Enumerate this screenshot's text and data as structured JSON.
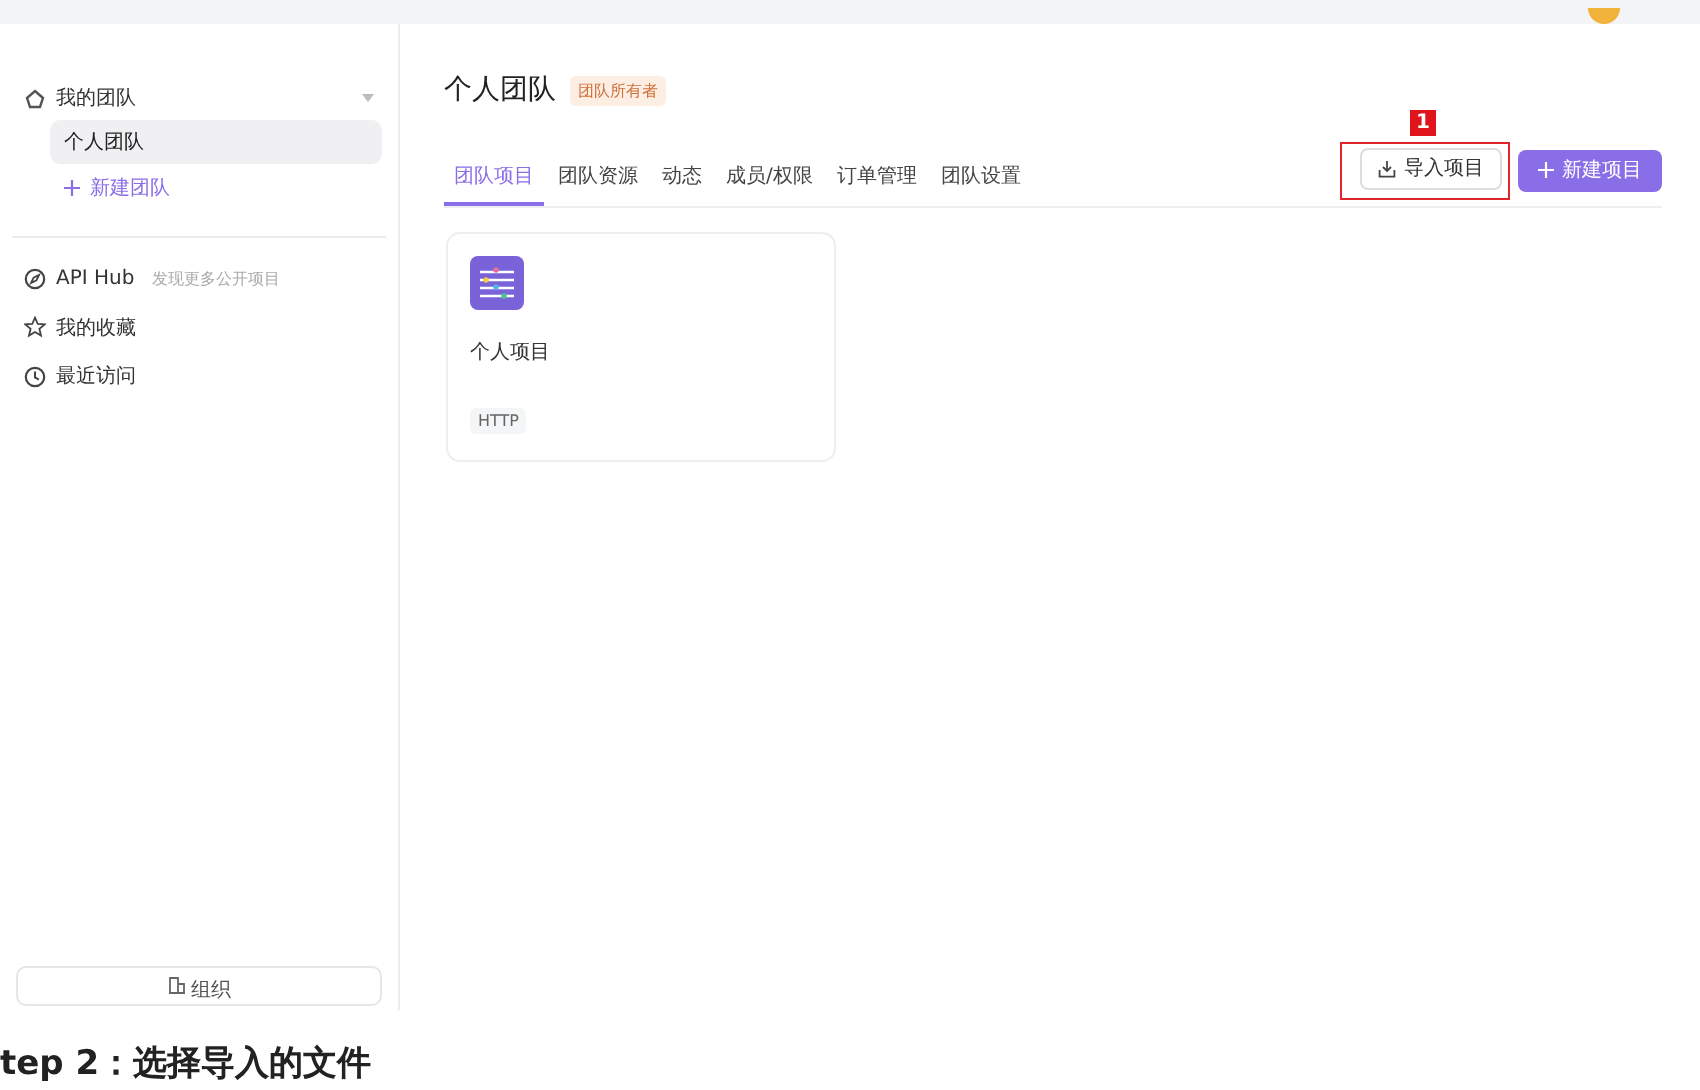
{
  "sidebar": {
    "team_group": {
      "label": "我的团队",
      "expanded": true
    },
    "teams": [
      {
        "label": "个人团队",
        "selected": true
      }
    ],
    "new_team": "新建团队",
    "nav_items": [
      {
        "kind": "hub",
        "label": "API Hub",
        "hint": "发现更多公开项目"
      },
      {
        "kind": "favorites",
        "label": "我的收藏"
      },
      {
        "kind": "recent",
        "label": "最近访问"
      }
    ],
    "org_button": "组织"
  },
  "main": {
    "title": "个人团队",
    "role_badge": "团队所有者",
    "tabs": [
      {
        "label": "团队项目",
        "selected": true
      },
      {
        "label": "团队资源",
        "selected": false
      },
      {
        "label": "动态",
        "selected": false
      },
      {
        "label": "成员/权限",
        "selected": false
      },
      {
        "label": "订单管理",
        "selected": false
      },
      {
        "label": "团队设置",
        "selected": false
      }
    ],
    "import_button": "导入项目",
    "annotation_marker": "1",
    "new_button": "新建项目",
    "projects": [
      {
        "name": "个人项目",
        "tag": "HTTP"
      }
    ]
  },
  "caption": "tep 2：选择导入的文件"
}
